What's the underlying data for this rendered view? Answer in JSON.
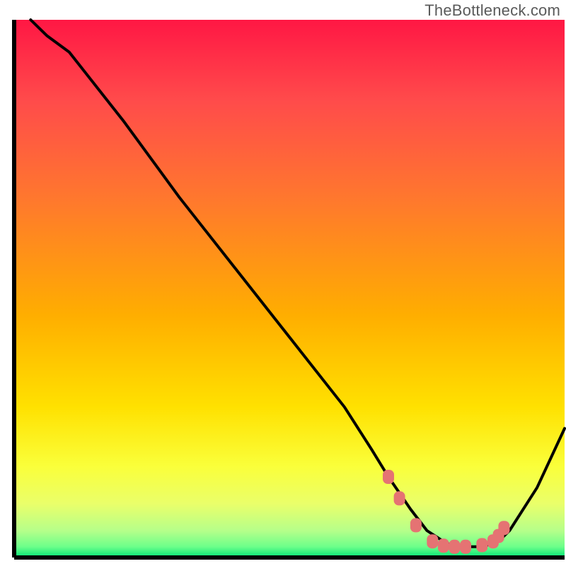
{
  "watermark": "TheBottleneck.com",
  "chart_data": {
    "type": "line",
    "title": "",
    "xlabel": "",
    "ylabel": "",
    "xlim": [
      0,
      100
    ],
    "ylim": [
      0,
      100
    ],
    "background_gradient": {
      "orientation": "vertical",
      "stops": [
        {
          "offset": 0.0,
          "color": "#ff1744"
        },
        {
          "offset": 0.15,
          "color": "#ff4b4b"
        },
        {
          "offset": 0.33,
          "color": "#ff772e"
        },
        {
          "offset": 0.55,
          "color": "#ffae00"
        },
        {
          "offset": 0.72,
          "color": "#ffe100"
        },
        {
          "offset": 0.83,
          "color": "#faff3a"
        },
        {
          "offset": 0.9,
          "color": "#eaff6a"
        },
        {
          "offset": 0.95,
          "color": "#b6ff8a"
        },
        {
          "offset": 0.98,
          "color": "#6cff8a"
        },
        {
          "offset": 1.0,
          "color": "#00e676"
        }
      ]
    },
    "series": [
      {
        "name": "bottleneck-curve",
        "color": "#000000",
        "x": [
          3,
          6,
          10,
          20,
          30,
          40,
          50,
          60,
          65,
          68,
          70,
          72,
          75,
          78,
          80,
          82,
          85,
          88,
          90,
          95,
          100
        ],
        "y": [
          100,
          97,
          94,
          81,
          67,
          54,
          41,
          28,
          20,
          15,
          12,
          9,
          5,
          3,
          2,
          2,
          2,
          3,
          5,
          13,
          24
        ]
      }
    ],
    "markers": {
      "name": "highlight-dots",
      "color": "#e57373",
      "shape": "rounded-rect",
      "x": [
        68,
        70,
        73,
        76,
        78,
        80,
        82,
        85,
        87,
        88,
        89
      ],
      "y": [
        15,
        11,
        6,
        3,
        2.2,
        2,
        2,
        2.3,
        3,
        4,
        5.5
      ]
    }
  }
}
